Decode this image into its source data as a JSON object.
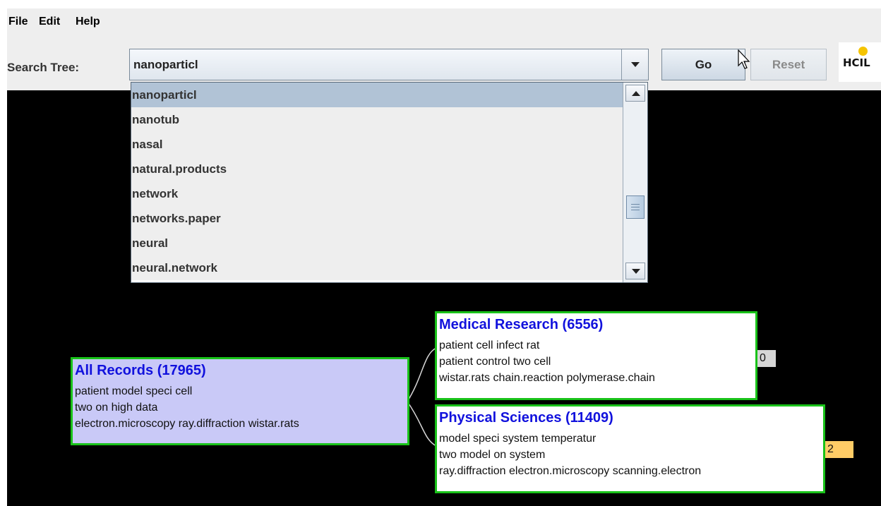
{
  "menu": {
    "file": "File",
    "edit": "Edit",
    "help": "Help"
  },
  "toolbar": {
    "search_label": "Search Tree:",
    "search_value": "nanoparticl",
    "go_label": "Go",
    "reset_label": "Reset",
    "logo_text": "HCIL"
  },
  "dropdown": {
    "items": [
      "nanoparticl",
      "nanotub",
      "nasal",
      "natural.products",
      "network",
      "networks.paper",
      "neural",
      "neural.network"
    ],
    "selected": "nanoparticl"
  },
  "tree": {
    "root": {
      "title": "All Records (17965)",
      "lines": [
        "patient model speci cell",
        "two on high data",
        "electron.microscopy ray.diffraction wistar.rats"
      ]
    },
    "children": [
      {
        "title": "Medical Research (6556)",
        "lines": [
          "patient cell infect rat",
          "patient control two cell",
          "wistar.rats chain.reaction polymerase.chain"
        ],
        "badge": "0"
      },
      {
        "title": "Physical Sciences (11409)",
        "lines": [
          "model speci system temperatur",
          "two model on system",
          "ray.diffraction electron.microscopy scanning.electron"
        ],
        "badge": "2"
      }
    ]
  },
  "colors": {
    "background": "#000000",
    "node_border": "#19c219",
    "node_title": "#1111dd",
    "root_fill": "#c9c9f7",
    "child_fill": "#ffffff",
    "selection": "#b1c3d6",
    "badge_gray": "#d6d6d6",
    "badge_orange": "#ffcc66"
  }
}
